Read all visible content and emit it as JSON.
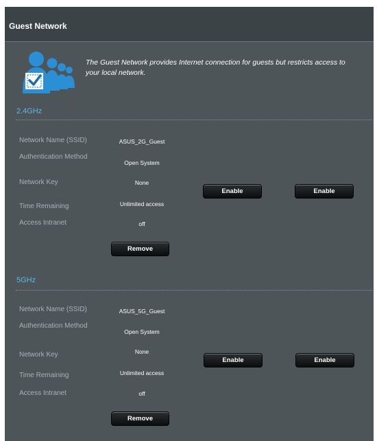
{
  "header": {
    "title": "Guest Network"
  },
  "intro": {
    "icon": "guest-users-checkbox-icon",
    "description": "The Guest Network provides Internet connection for guests but restricts access to your local network."
  },
  "bands": [
    {
      "name": "2.4GHz",
      "rows": [
        {
          "label": "Network Name (SSID)",
          "value": "ASUS_2G_Guest"
        },
        {
          "label": "Authentication Method",
          "value": "Open System"
        },
        {
          "label": "Network Key",
          "value": "None"
        },
        {
          "label": "Time Remaining",
          "value": "Unlimited access"
        },
        {
          "label": "Access Intranet",
          "value": "off"
        }
      ],
      "enable_buttons": [
        "Enable",
        "Enable"
      ],
      "remove_label": "Remove"
    },
    {
      "name": "5GHz",
      "rows": [
        {
          "label": "Network Name (SSID)",
          "value": "ASUS_5G_Guest"
        },
        {
          "label": "Authentication Method",
          "value": "Open System"
        },
        {
          "label": "Network Key",
          "value": "None"
        },
        {
          "label": "Time Remaining",
          "value": "Unlimited access"
        },
        {
          "label": "Access Intranet",
          "value": "off"
        }
      ],
      "enable_buttons": [
        "Enable",
        "Enable"
      ],
      "remove_label": "Remove"
    }
  ],
  "colors": {
    "panel_bg": "#4d5559",
    "title_bg": "#3b4346",
    "band_label": "#5ab8e6",
    "icon_blue": "#2a8fd4"
  }
}
